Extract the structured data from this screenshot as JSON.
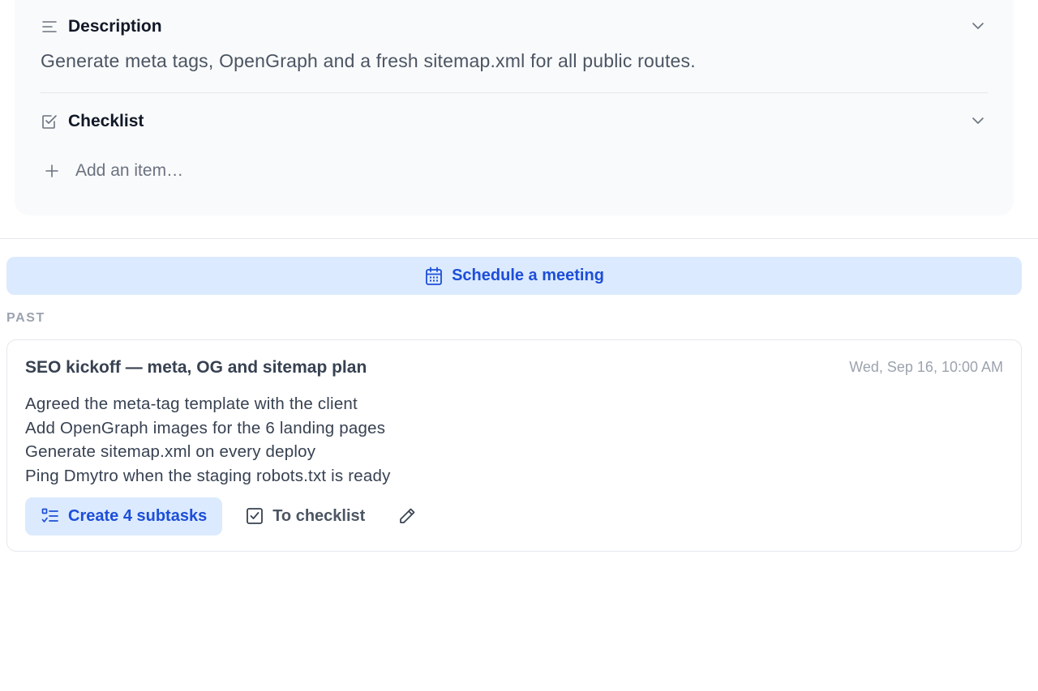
{
  "description": {
    "title": "Description",
    "icon": "align-left-icon",
    "text": "Generate meta tags, OpenGraph and a fresh sitemap.xml for all public routes."
  },
  "checklist": {
    "title": "Checklist",
    "icon": "checkbox-icon",
    "add_placeholder": "Add an item…"
  },
  "meeting": {
    "button_label": "Schedule a meeting",
    "icon": "calendar-icon"
  },
  "past": {
    "label": "PAST",
    "meetings": [
      {
        "title": "SEO kickoff — meta, OG and sitemap plan",
        "date": "Wed, Sep 16, 10:00 AM",
        "notes": [
          "Agreed the meta-tag template with the client",
          "Add OpenGraph images for the 6 landing pages",
          "Generate sitemap.xml on every deploy",
          "Ping Dmytro when the staging robots.txt is ready"
        ],
        "actions": {
          "create_subtasks": "Create 4 subtasks",
          "to_checklist": "To checklist"
        }
      }
    ]
  },
  "colors": {
    "accent": "#1d4ed8",
    "accent_bg": "#dbeafe",
    "muted": "#9ca3af",
    "panel_bg": "#f9fafb"
  }
}
